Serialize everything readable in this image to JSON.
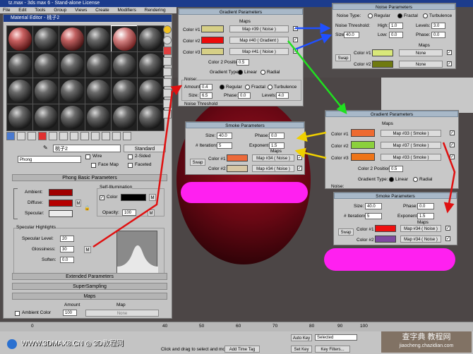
{
  "window_title": "tz.max - 3ds max 6 - Stand-alone License",
  "menu": [
    "File",
    "Edit",
    "Tools",
    "Group",
    "Views",
    "Create",
    "Modifiers",
    "Rendering"
  ],
  "material_editor": {
    "title": "Material Editor - 桃子2",
    "material_name": "桃子2",
    "type_button": "Standard",
    "shader": "Phong",
    "shader_options": {
      "wire": "Wire",
      "two_sided": "2-Sided",
      "face_map": "Face Map",
      "faceted": "Faceted"
    },
    "phong_title": "Phong Basic Parameters",
    "self_illum_title": "Self-Illumination",
    "ambient_label": "Ambient:",
    "diffuse_label": "Diffuse:",
    "specular_label": "Specular:",
    "color_label": "Color",
    "opacity_label": "Opacity:",
    "opacity_value": "100",
    "spec_title": "Specular Highlights",
    "spec_level_label": "Specular Level:",
    "spec_level": "20",
    "gloss_label": "Glossiness:",
    "gloss": "30",
    "soften_label": "Soften:",
    "soften": "0.0",
    "extended": "Extended Parameters",
    "supersampling": "SuperSampling",
    "maps": "Maps",
    "maps_amount": "Amount",
    "maps_map": "Map",
    "ambient_color_row": "Ambient Color",
    "ambient_color_amount": "100",
    "ambient_color_map": "None",
    "m": "M",
    "colors": {
      "ambient": "#a00000",
      "diffuse": "#b50000",
      "specular": "#ececec",
      "self_illum": "#000000"
    }
  },
  "gradient_main": {
    "title": "Gradient Parameters",
    "maps_header": "Maps",
    "color1": "Color #1",
    "color2": "Color #2",
    "color3": "Color #3",
    "map1": "Map #39  ( Noise )",
    "map2": "Map #40  ( Gradient )",
    "map3": "Map #41  ( Noise )",
    "c2pos_label": "Color 2 Position:",
    "c2pos": "0.5",
    "type_label": "Gradient Type:",
    "linear": "Linear",
    "radial": "Radial",
    "noise_title": "Noise:",
    "amount_label": "Amount:",
    "amount": "0.4",
    "regular": "Regular",
    "fractal": "Fractal",
    "turbulence": "Turbulence",
    "size_label": "Size:",
    "size": "6.5",
    "phase_label": "Phase:",
    "phase": "0.0",
    "levels_label": "Levels:",
    "levels": "4.0",
    "noise_threshold": "Noise Threshold",
    "colors": {
      "c1": "#d6cf86",
      "c2": "#ec0a0a",
      "c3": "#d6cf86"
    }
  },
  "noise_params": {
    "title": "Noise Parameters",
    "type_label": "Noise Type:",
    "regular": "Regular",
    "fractal": "Fractal",
    "turbulence": "Turbulence",
    "threshold_label": "Noise Threshold:",
    "high_label": "High:",
    "high": "1.0",
    "levels_label": "Levels:",
    "levels": "3.0",
    "size_label": "Size:",
    "size": "40.0",
    "low_label": "Low:",
    "low": "0.0",
    "phase_label": "Phase:",
    "phase": "0.0",
    "maps_header": "Maps",
    "swap": "Swap",
    "color1": "Color #1",
    "color2": "Color #2",
    "none1": "None",
    "none2": "None",
    "colors": {
      "c1": "#d9e87a",
      "c2": "#6f7a10"
    }
  },
  "smoke_left": {
    "title": "Smoke Parameters",
    "size_label": "Size:",
    "size": "40.0",
    "phase_label": "Phase:",
    "phase": "0.0",
    "iter_label": "# Iterations:",
    "iter": "5",
    "exp_label": "Exponent:",
    "exp": "1.5",
    "maps_header": "Maps",
    "swap": "Swap",
    "color1": "Color #1",
    "color2": "Color #2",
    "map1": "Map #34  ( Noise )",
    "map2": "Map #34  ( Noise )",
    "colors": {
      "c1": "#ec6a3a",
      "c2": "#d6c6a4"
    }
  },
  "gradient_right": {
    "title": "Gradient Parameters",
    "maps_header": "Maps",
    "color1": "Color #1",
    "color2": "Color #2",
    "color3": "Color #3",
    "map1": "Map #33  ( Smoke )",
    "map2": "Map #37  ( Smoke )",
    "map3": "Map #33  ( Smoke )",
    "c2pos_label": "Color 2 Position:",
    "c2pos": "0.5",
    "type_label": "Gradient Type:",
    "linear": "Linear",
    "radial": "Radial",
    "noise": "Noise:",
    "colors": {
      "c1": "#ee6a30",
      "c2": "#8bd03c",
      "c3": "#ee7418"
    }
  },
  "smoke_right": {
    "title": "Smoke Parameters",
    "size_label": "Size:",
    "size": "40.0",
    "phase_label": "Phase:",
    "phase": "0.0",
    "iter_label": "# Iterations:",
    "iter": "5",
    "exp_label": "Exponent:",
    "exp": "1.5",
    "maps_header": "Maps",
    "swap": "Swap",
    "color1": "Color #1",
    "color2": "Color #2",
    "map1": "Map #34  ( Noise )",
    "map2": "Map #34  ( Noise )",
    "colors": {
      "c1": "#ee1010",
      "c2": "#7e4aa0"
    }
  },
  "timeline": {
    "ticks": [
      "40",
      "50",
      "60",
      "70",
      "80",
      "90",
      "100"
    ],
    "start": "0"
  },
  "status": {
    "hint": "Click and drag to select and move",
    "add_time_tag": "Add Time Tag",
    "auto_key": "Auto Key",
    "set_key": "Set Key",
    "selected": "Selected",
    "key_filters": "Key Filters..."
  },
  "watermark_left": "WWW.3DMAX8.CN ◎ 3D教程网",
  "watermark_right": {
    "line1": "查字典 教程网",
    "line2": "jiaocheng.chazidian.com"
  },
  "accent_colors": {
    "highlight": "#ff20f0",
    "arrow_red": "#e01010",
    "arrow_green": "#20e020",
    "arrow_blue": "#2050ff",
    "arrow_yellow": "#f0d000"
  }
}
